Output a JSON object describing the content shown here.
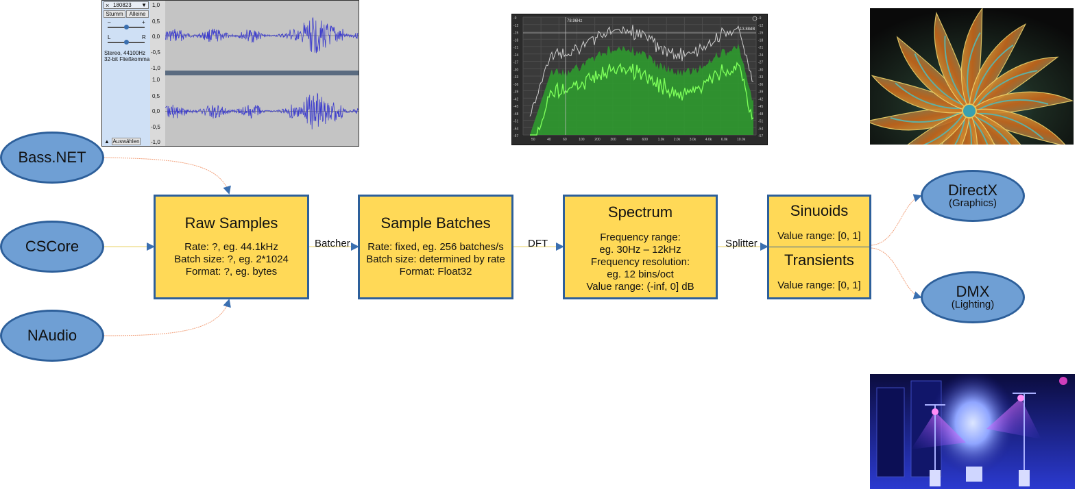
{
  "sources": {
    "bass": "Bass.NET",
    "cscore": "CSCore",
    "naudio": "NAudio"
  },
  "raw_samples": {
    "title": "Raw Samples",
    "rate": "Rate: ?, eg. 44.1kHz",
    "batch_size": "Batch size: ?, eg. 2*1024",
    "format": "Format: ?, eg. bytes"
  },
  "sample_batches": {
    "title": "Sample Batches",
    "rate": "Rate: fixed, eg. 256 batches/s",
    "batch_size": "Batch size: determined by rate",
    "format": "Format: Float32"
  },
  "spectrum": {
    "title": "Spectrum",
    "freq_range_label": "Frequency range:",
    "freq_range_value": "eg. 30Hz – 12kHz",
    "freq_res_label": "Frequency resolution:",
    "freq_res_value": "eg. 12 bins/oct",
    "value_range": "Value range: (-inf, 0] dB"
  },
  "sinuoids": {
    "title": "Sinuoids",
    "value_range": "Value range: [0, 1]"
  },
  "transients": {
    "title": "Transients",
    "value_range": "Value range: [0, 1]"
  },
  "edges": {
    "batcher": "Batcher",
    "dft": "DFT",
    "splitter": "Splitter"
  },
  "outputs": {
    "directx": "DirectX",
    "directx_sub": "(Graphics)",
    "dmx": "DMX",
    "dmx_sub": "(Lighting)"
  },
  "audacity": {
    "track_name": "180823",
    "mute": "Stumm",
    "solo": "Alleine",
    "info_line1": "Stereo, 44100Hz",
    "info_line2": "32-bit Fließkomma",
    "select": "Auswählen",
    "gain_minus": "–",
    "gain_plus": "+",
    "pan_l": "L",
    "pan_r": "R",
    "scale": [
      "1,0",
      "0,5",
      "0,0",
      "-0,5",
      "-1,0"
    ]
  },
  "spectrum_screenshot": {
    "cursor_freq": "78.96Hz",
    "cursor_db": "-13.88dB",
    "x_ticks": [
      "50",
      "40",
      "60",
      "100",
      "200",
      "300",
      "400",
      "600",
      "1.0k",
      "2.0k",
      "3.0k",
      "4.0k",
      "6.0k",
      "10.0k"
    ],
    "y_ticks_left": [
      "-9",
      "-12",
      "-15",
      "-18",
      "-21",
      "-24",
      "-27",
      "-30",
      "-33",
      "-36",
      "-39",
      "-42",
      "-45",
      "-48",
      "-51",
      "-54",
      "-57"
    ],
    "y_ticks_right": [
      "-9",
      "-12",
      "-15",
      "-18",
      "-21",
      "-24",
      "-27",
      "-30",
      "-33",
      "-36",
      "-39",
      "-42",
      "-45",
      "-48",
      "-51",
      "-54",
      "-57"
    ],
    "colors": {
      "fill": "#2f9a2f",
      "line": "#7dff5a",
      "peak": "#cfcfcf"
    }
  },
  "colors": {
    "box_fill": "#ffd957",
    "box_border": "#2d5f9a",
    "ellipse_fill": "#6f9fd4",
    "edge_color": "#f2a07a",
    "arrowhead": "#3a6fb0"
  }
}
